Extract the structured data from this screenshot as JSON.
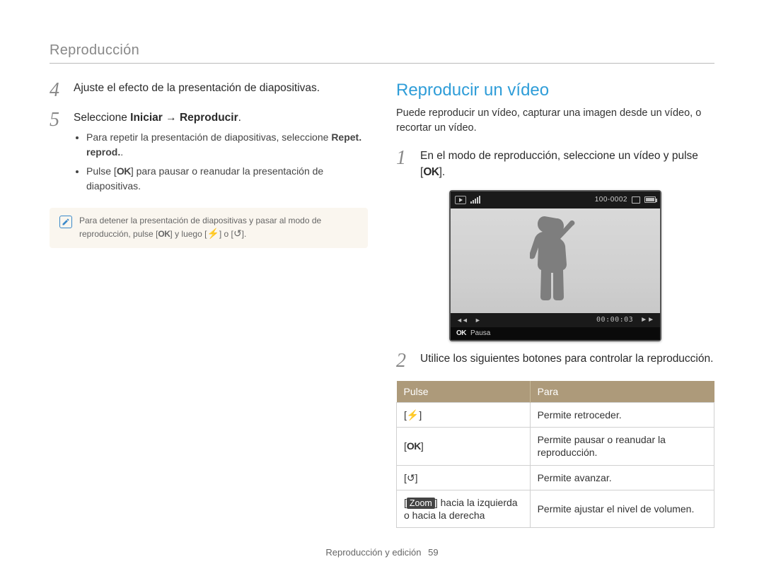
{
  "header": {
    "title": "Reproducción"
  },
  "left": {
    "step4": {
      "num": "4",
      "text": "Ajuste el efecto de la presentación de diapositivas."
    },
    "step5": {
      "num": "5",
      "prefix": "Seleccione ",
      "bold1": "Iniciar",
      "arrow": " → ",
      "bold2": "Reproducir",
      "suffix": ".",
      "bullet1a": "Para repetir la presentación de diapositivas, seleccione ",
      "bullet1b": "Repet. reprod.",
      "bullet1c": ".",
      "bullet2a": "Pulse [",
      "bullet2ok": "OK",
      "bullet2b": "] para pausar o reanudar la presentación de diapositivas."
    },
    "note": {
      "line1a": "Para detener la presentación de diapositivas y pasar al modo de reproducción, pulse [",
      "ok": "OK",
      "line1b": "] y luego [",
      "line1c": "] o [",
      "line1d": "]."
    }
  },
  "right": {
    "heading": "Reproducir un vídeo",
    "intro": "Puede reproducir un vídeo, capturar una imagen desde un vídeo, o recortar un vídeo.",
    "step1": {
      "num": "1",
      "text_a": "En el modo de reproducción, seleccione un vídeo y pulse [",
      "ok": "OK",
      "text_b": "]."
    },
    "screen": {
      "counter": "100-0002",
      "timecode": "00:00:03",
      "helper_ok": "OK",
      "helper_label": "Pausa"
    },
    "step2": {
      "num": "2",
      "text": "Utilice los siguientes botones para controlar la reproducción."
    },
    "table": {
      "head1": "Pulse",
      "head2": "Para",
      "rows": [
        {
          "key_prefix": "[",
          "key_icon": "flash",
          "key_suffix": "]",
          "desc": "Permite retroceder."
        },
        {
          "key_prefix": "[",
          "key_text": "OK",
          "key_suffix": "]",
          "desc": "Permite pausar o reanudar la reproducción."
        },
        {
          "key_prefix": "[",
          "key_icon": "timer",
          "key_suffix": "]",
          "desc": "Permite avanzar."
        },
        {
          "zoom_prefix": "[",
          "zoom_label": "Zoom",
          "zoom_mid": "] hacia la izquierda o hacia la derecha",
          "desc": "Permite ajustar el nivel de volumen."
        }
      ]
    }
  },
  "footer": {
    "text": "Reproducción y edición",
    "page": "59"
  }
}
